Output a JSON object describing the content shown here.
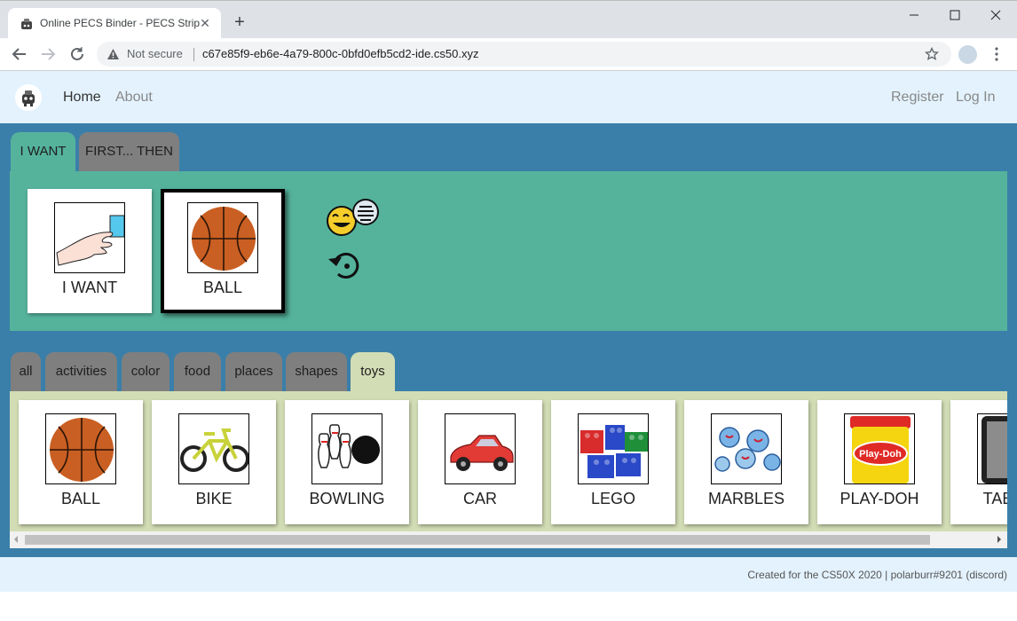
{
  "browser": {
    "tab_title": "Online PECS Binder - PECS Strip",
    "not_secure": "Not secure",
    "url": "c67e85f9-eb6e-4a79-800c-0bfd0efb5cd2-ide.cs50.xyz",
    "icons": [
      "favicon-icon",
      "close-icon",
      "plus-icon",
      "minimize-icon",
      "maximize-icon",
      "window-close-icon",
      "back-icon",
      "forward-icon",
      "reload-icon",
      "warning-icon",
      "star-icon",
      "profile-icon",
      "kebab-menu-icon"
    ]
  },
  "navbar": {
    "home": "Home",
    "about": "About",
    "register": "Register",
    "login": "Log In"
  },
  "strip_tabs": [
    {
      "label": "I WANT",
      "active": true
    },
    {
      "label": "FIRST... THEN",
      "active": false
    }
  ],
  "strip_cards": [
    {
      "label": "I WANT",
      "icon": "reaching-hand-icon"
    },
    {
      "label": "BALL",
      "icon": "basketball-icon",
      "selected": true
    }
  ],
  "strip_actions": {
    "speak_icon": "speaking-face-icon",
    "reset_icon": "reset-icon"
  },
  "category_tabs": [
    {
      "label": "all",
      "active": false
    },
    {
      "label": "activities",
      "active": false
    },
    {
      "label": "color",
      "active": false
    },
    {
      "label": "food",
      "active": false
    },
    {
      "label": "places",
      "active": false
    },
    {
      "label": "shapes",
      "active": false
    },
    {
      "label": "toys",
      "active": true
    }
  ],
  "library_cards": [
    {
      "label": "BALL",
      "icon": "basketball-icon"
    },
    {
      "label": "BIKE",
      "icon": "bike-icon"
    },
    {
      "label": "BOWLING",
      "icon": "bowling-icon"
    },
    {
      "label": "CAR",
      "icon": "toy-car-icon"
    },
    {
      "label": "LEGO",
      "icon": "lego-bricks-icon"
    },
    {
      "label": "MARBLES",
      "icon": "marbles-icon"
    },
    {
      "label": "PLAY-DOH",
      "icon": "play-doh-icon"
    },
    {
      "label": "TABLET",
      "icon": "tablet-icon"
    }
  ],
  "play_doh_logo_text": "Play-Doh",
  "footer": {
    "text": "Created for the CS50X 2020 | polarburr#9201 (discord)"
  },
  "colors": {
    "main_background": "#3a7fa9",
    "strip_panel": "#55b39c",
    "inactive_tab": "#7f7f7f",
    "library_panel": "#d3ddb5",
    "navbar_background": "#e3f2fd"
  }
}
